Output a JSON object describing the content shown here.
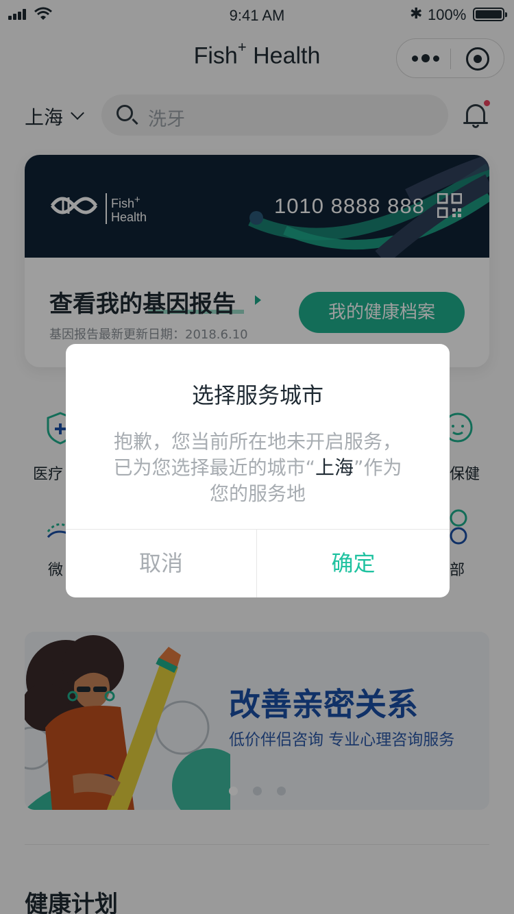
{
  "status_bar": {
    "time": "9:41 AM",
    "battery": "100%"
  },
  "nav": {
    "title": "Fish",
    "title_sup": "+",
    "title_tail": " Health"
  },
  "location": {
    "city": "上海"
  },
  "search": {
    "placeholder": "洗牙"
  },
  "member_card": {
    "logo_text_1": "Fish",
    "logo_text_sup": "+",
    "logo_text_2": "Health",
    "card_number": "1010 8888 888",
    "report_title": "查看我的基因报告",
    "report_updated": "基因报告最新更新日期：2018.6.10",
    "health_record_button": "我的健康档案"
  },
  "services": {
    "visible_labels": [
      "医疗",
      "保健",
      "微",
      "部"
    ]
  },
  "banner": {
    "headline": "改善亲密关系",
    "subtitle": "低价伴侣咨询 专业心理咨询服务",
    "active_dot": 1,
    "dot_count": 3
  },
  "section": {
    "title": "健康计划"
  },
  "dialog": {
    "title": "选择服务城市",
    "message_prefix": "抱歉，您当前所在地未开启服务，已为您选择最近的城市“",
    "message_city": "上海",
    "message_suffix": "”作为您的服务地",
    "cancel_label": "取消",
    "confirm_label": "确定"
  },
  "colors": {
    "accent": "#1fb08f",
    "confirm": "#1fc2a0",
    "card_dark": "#0f2236",
    "banner_text": "#1b4fa6"
  }
}
